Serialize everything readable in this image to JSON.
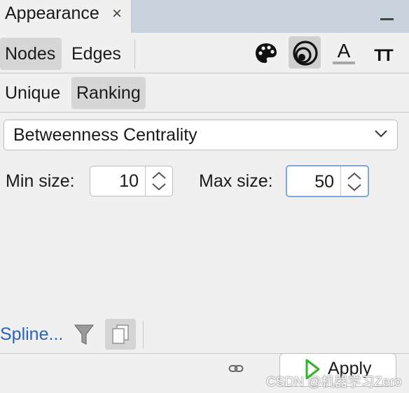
{
  "panel": {
    "tab_title": "Appearance",
    "close_glyph": "×"
  },
  "element_toggle": {
    "nodes_label": "Nodes",
    "edges_label": "Edges",
    "selected": "Nodes"
  },
  "attribute_tools": {
    "items": [
      {
        "icon": "palette-icon",
        "selected": false
      },
      {
        "icon": "size-icon",
        "selected": true
      },
      {
        "icon": "label-color-icon",
        "selected": false
      },
      {
        "icon": "label-size-icon",
        "selected": false
      }
    ],
    "label_color_glyph": "A",
    "label_size_glyph": "TT"
  },
  "mode_toggle": {
    "unique_label": "Unique",
    "ranking_label": "Ranking",
    "selected": "Ranking"
  },
  "ranking": {
    "attribute": "Betweenness Centrality",
    "min_size_label": "Min size:",
    "min_size_value": "10",
    "max_size_label": "Max size:",
    "max_size_value": "50"
  },
  "footer": {
    "spline_link": "Spline...",
    "apply_label": "Apply",
    "apply_icon_color": "#2fb52a"
  },
  "watermark": "CSDN @机器学习Zero"
}
